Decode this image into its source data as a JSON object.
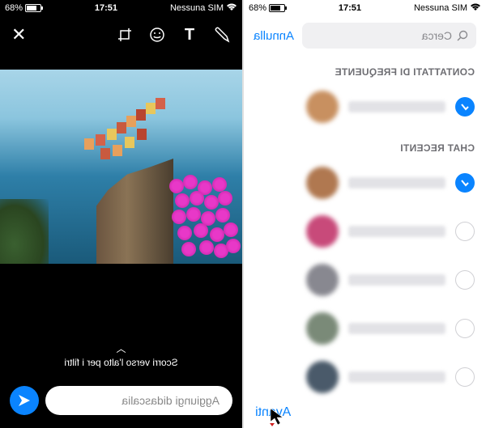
{
  "status_bar": {
    "carrier": "Nessuna SIM",
    "time": "17:51",
    "battery_pct": "68%"
  },
  "editor": {
    "filter_hint": "Scorri verso l'alto per i filtri",
    "caption_placeholder": "Aggiungi didascalia"
  },
  "share": {
    "search_placeholder": "Cerca",
    "cancel_label": "Annulla",
    "section_frequent": "CONTATTATI DI FREQUENTE",
    "section_recent": "CHAT RECENTI",
    "next_label": "Avanti",
    "contacts_frequent": [
      {
        "selected": true,
        "avatar_color": "#c89060"
      }
    ],
    "contacts_recent": [
      {
        "selected": true,
        "avatar_color": "#b07850"
      },
      {
        "selected": false,
        "avatar_color": "#c84a7a"
      },
      {
        "selected": false,
        "avatar_color": "#888890"
      },
      {
        "selected": false,
        "avatar_color": "#7a8a78"
      },
      {
        "selected": false,
        "avatar_color": "#4a5a6a"
      }
    ]
  },
  "colors": {
    "accent": "#0a84ff"
  }
}
